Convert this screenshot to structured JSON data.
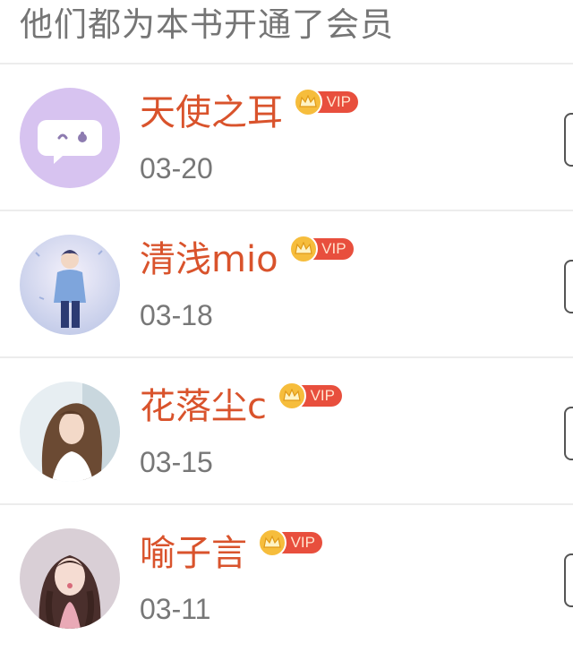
{
  "header": {
    "title": "他们都为本书开通了会员"
  },
  "members": [
    {
      "name": "天使之耳",
      "date": "03-20",
      "badge": "VIP",
      "avatar": "chat-bubble-icon"
    },
    {
      "name": "清浅mio",
      "date": "03-18",
      "badge": "VIP",
      "avatar": "anime-boy-photo"
    },
    {
      "name": "花落尘c",
      "date": "03-15",
      "badge": "VIP",
      "avatar": "girl-photo"
    },
    {
      "name": "喻子言",
      "date": "03-11",
      "badge": "VIP",
      "avatar": "girl-braids-photo"
    }
  ],
  "colors": {
    "name": "#d9532c",
    "vip_pill": "#e84f3d",
    "crown": "#f6bd3c",
    "date": "#777777",
    "title": "#757575"
  }
}
